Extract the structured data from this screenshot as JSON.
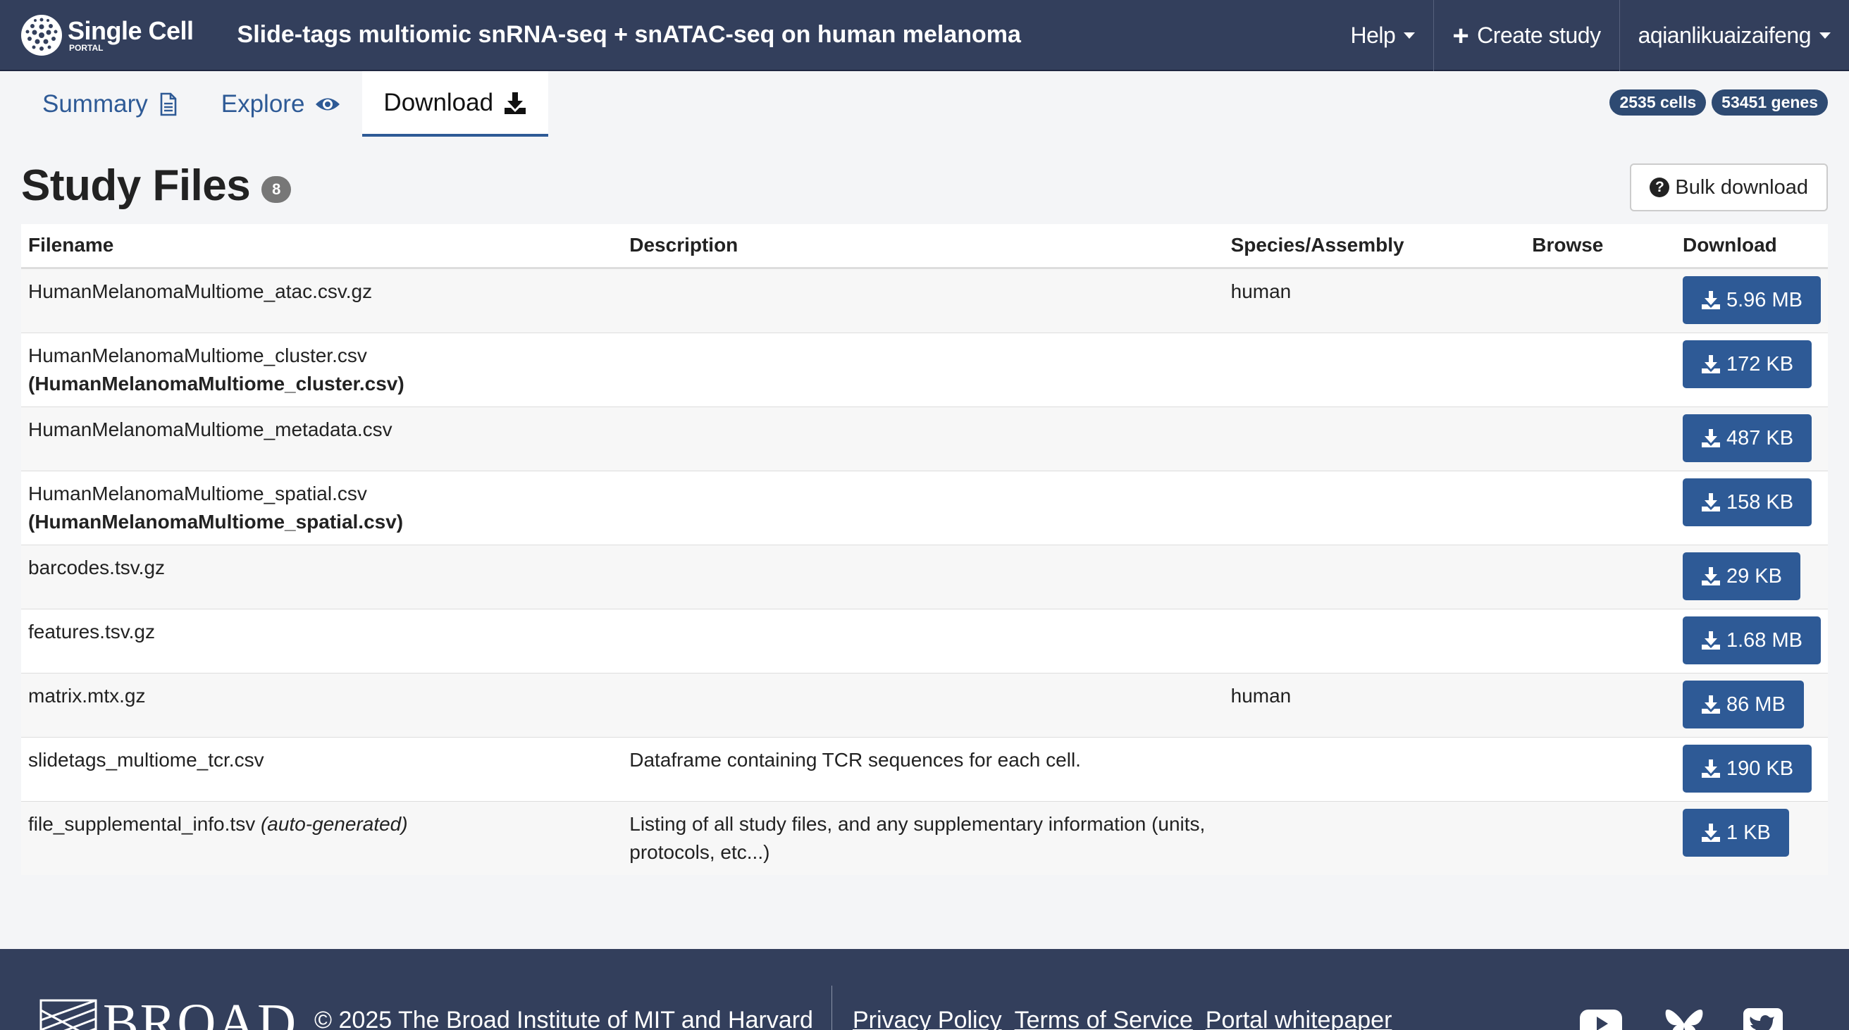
{
  "navbar": {
    "brand": "Single Cell",
    "brand_sub": "PORTAL",
    "study_title": "Slide-tags multiomic snRNA-seq + snATAC-seq on human melanoma",
    "help_label": "Help",
    "create_label": "Create study",
    "user_label": "aqianlikuaizaifeng"
  },
  "tabs": [
    {
      "label": "Summary",
      "icon": "file-text-icon"
    },
    {
      "label": "Explore",
      "icon": "eye-icon"
    },
    {
      "label": "Download",
      "icon": "download-icon",
      "active": true
    }
  ],
  "stats": {
    "cells": "2535 cells",
    "genes": "53451 genes"
  },
  "heading": {
    "title": "Study Files",
    "count": "8",
    "bulk_download_label": "Bulk download"
  },
  "table": {
    "headers": [
      "Filename",
      "Description",
      "Species/Assembly",
      "Browse",
      "Download"
    ],
    "rows": [
      {
        "filename": "HumanMelanomaMultiome_atac.csv.gz",
        "subname": "",
        "auto": "",
        "description": "",
        "species": "human",
        "browse": "",
        "size": "5.96 MB"
      },
      {
        "filename": "HumanMelanomaMultiome_cluster.csv",
        "subname": "(HumanMelanomaMultiome_cluster.csv)",
        "auto": "",
        "description": "",
        "species": "",
        "browse": "",
        "size": "172 KB"
      },
      {
        "filename": "HumanMelanomaMultiome_metadata.csv",
        "subname": "",
        "auto": "",
        "description": "",
        "species": "",
        "browse": "",
        "size": "487 KB"
      },
      {
        "filename": "HumanMelanomaMultiome_spatial.csv",
        "subname": "(HumanMelanomaMultiome_spatial.csv)",
        "auto": "",
        "description": "",
        "species": "",
        "browse": "",
        "size": "158 KB"
      },
      {
        "filename": "barcodes.tsv.gz",
        "subname": "",
        "auto": "",
        "description": "",
        "species": "",
        "browse": "",
        "size": "29 KB"
      },
      {
        "filename": "features.tsv.gz",
        "subname": "",
        "auto": "",
        "description": "",
        "species": "",
        "browse": "",
        "size": "1.68 MB"
      },
      {
        "filename": "matrix.mtx.gz",
        "subname": "",
        "auto": "",
        "description": "",
        "species": "human",
        "browse": "",
        "size": "86 MB"
      },
      {
        "filename": "slidetags_multiome_tcr.csv",
        "subname": "",
        "auto": "",
        "description": "Dataframe containing TCR sequences for each cell.",
        "species": "",
        "browse": "",
        "size": "190 KB"
      },
      {
        "filename": "file_supplemental_info.tsv ",
        "subname": "",
        "auto": "(auto-generated)",
        "description": "Listing of all study files, and any supplementary information (units, protocols, etc...)",
        "species": "",
        "browse": "",
        "size": "1 KB"
      }
    ]
  },
  "footer": {
    "broad": "BROAD",
    "copyright": "© 2025 The Broad Institute of MIT and Harvard",
    "links": [
      "Privacy Policy",
      "Terms of Service",
      "Portal whitepaper"
    ],
    "social_icons": [
      "youtube-icon",
      "bluesky-icon",
      "twitter-icon"
    ]
  },
  "colors": {
    "navbar": "#333f5c",
    "accent": "#2e5a96",
    "badge": "#2e4a72"
  }
}
